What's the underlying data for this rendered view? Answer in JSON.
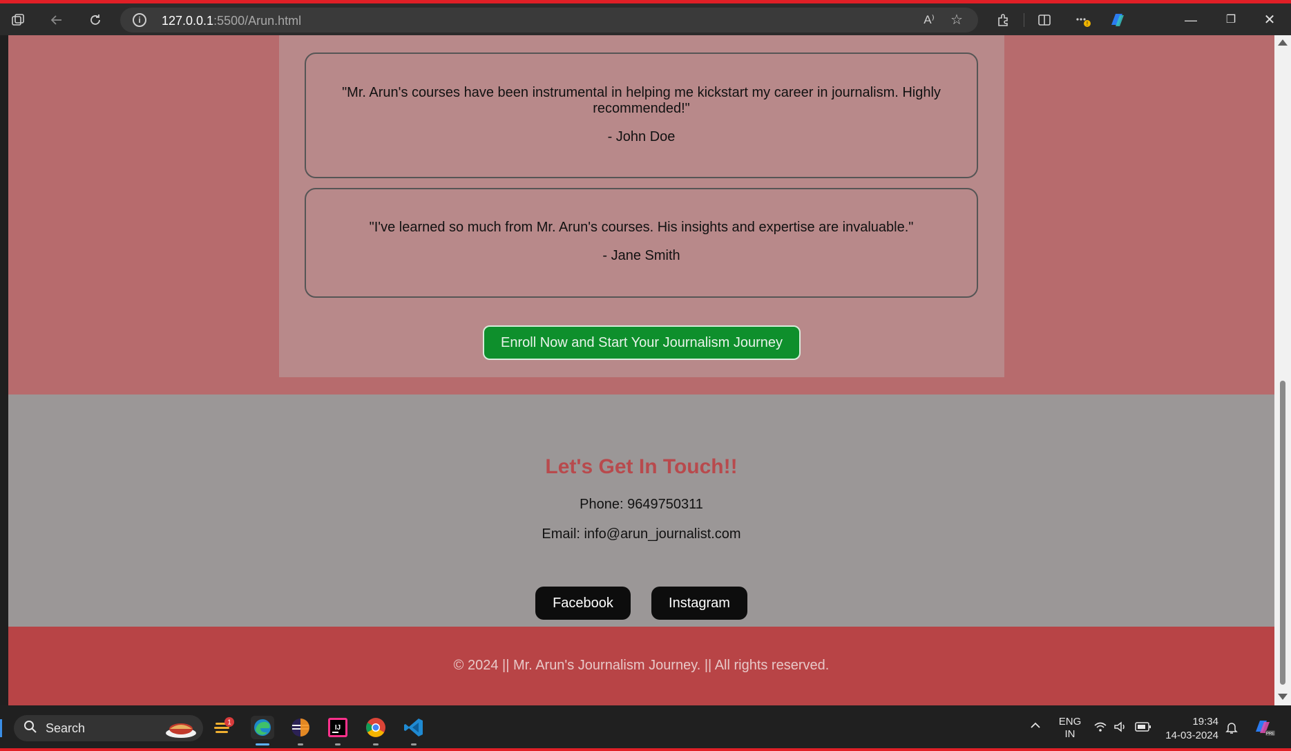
{
  "browser": {
    "url_host": "127.0.0.1",
    "url_path": ":5500/Arun.html",
    "read_aloud_glyph": "A⁾"
  },
  "testimonials": [
    {
      "quote": "\"Mr. Arun's courses have been instrumental in helping me kickstart my career in journalism. Highly recommended!\"",
      "author": "- John Doe"
    },
    {
      "quote": "\"I've learned so much from Mr. Arun's courses. His insights and expertise are invaluable.\"",
      "author": "- Jane Smith"
    }
  ],
  "enroll_button": "Enroll Now and Start Your Journalism Journey",
  "contact": {
    "heading": "Let's Get In Touch!!",
    "phone": "Phone: 9649750311",
    "email": "Email: info@arun_journalist.com",
    "facebook": "Facebook",
    "instagram": "Instagram"
  },
  "footer": {
    "copyright": "© 2024 || Mr. Arun's Journalism Journey. || All rights reserved."
  },
  "taskbar": {
    "search_label": "Search",
    "notification_badge": "1",
    "language_top": "ENG",
    "language_bottom": "IN",
    "time": "19:34",
    "date": "14-03-2024"
  },
  "colors": {
    "page_background": "#b76b6d",
    "testimonial_panel": "#b8898a",
    "contact_background": "#9b9797",
    "heading": "#b84a4d",
    "enroll_button": "#0e8f2c",
    "footer": "#b84446"
  }
}
